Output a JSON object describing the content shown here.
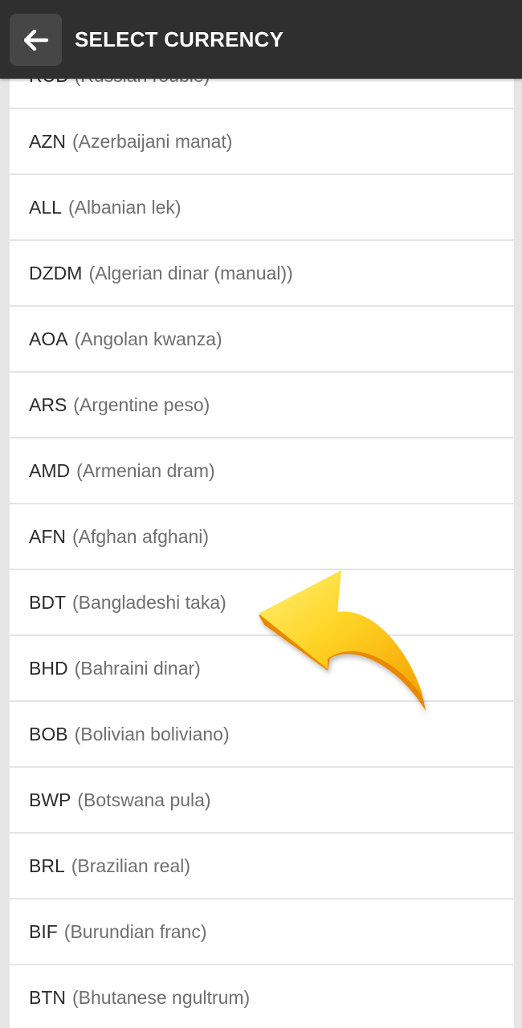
{
  "header": {
    "title": "SELECT CURRENCY",
    "back_icon": "arrow-left-icon"
  },
  "currencies": [
    {
      "code": "RUB",
      "name": "(Russian rouble)"
    },
    {
      "code": "AZN",
      "name": "(Azerbaijani manat)"
    },
    {
      "code": "ALL",
      "name": "(Albanian lek)"
    },
    {
      "code": "DZDM",
      "name": "(Algerian dinar (manual))"
    },
    {
      "code": "AOA",
      "name": "(Angolan kwanza)"
    },
    {
      "code": "ARS",
      "name": "(Argentine peso)"
    },
    {
      "code": "AMD",
      "name": "(Armenian dram)"
    },
    {
      "code": "AFN",
      "name": "(Afghan afghani)"
    },
    {
      "code": "BDT",
      "name": "(Bangladeshi taka)"
    },
    {
      "code": "BHD",
      "name": "(Bahraini dinar)"
    },
    {
      "code": "BOB",
      "name": "(Bolivian boliviano)"
    },
    {
      "code": "BWP",
      "name": "(Botswana pula)"
    },
    {
      "code": "BRL",
      "name": "(Brazilian real)"
    },
    {
      "code": "BIF",
      "name": "(Burundian franc)"
    },
    {
      "code": "BTN",
      "name": "(Bhutanese ngultrum)"
    }
  ],
  "overlay": {
    "icon": "curved-arrow-pointer-icon",
    "color": "#f7b500"
  }
}
